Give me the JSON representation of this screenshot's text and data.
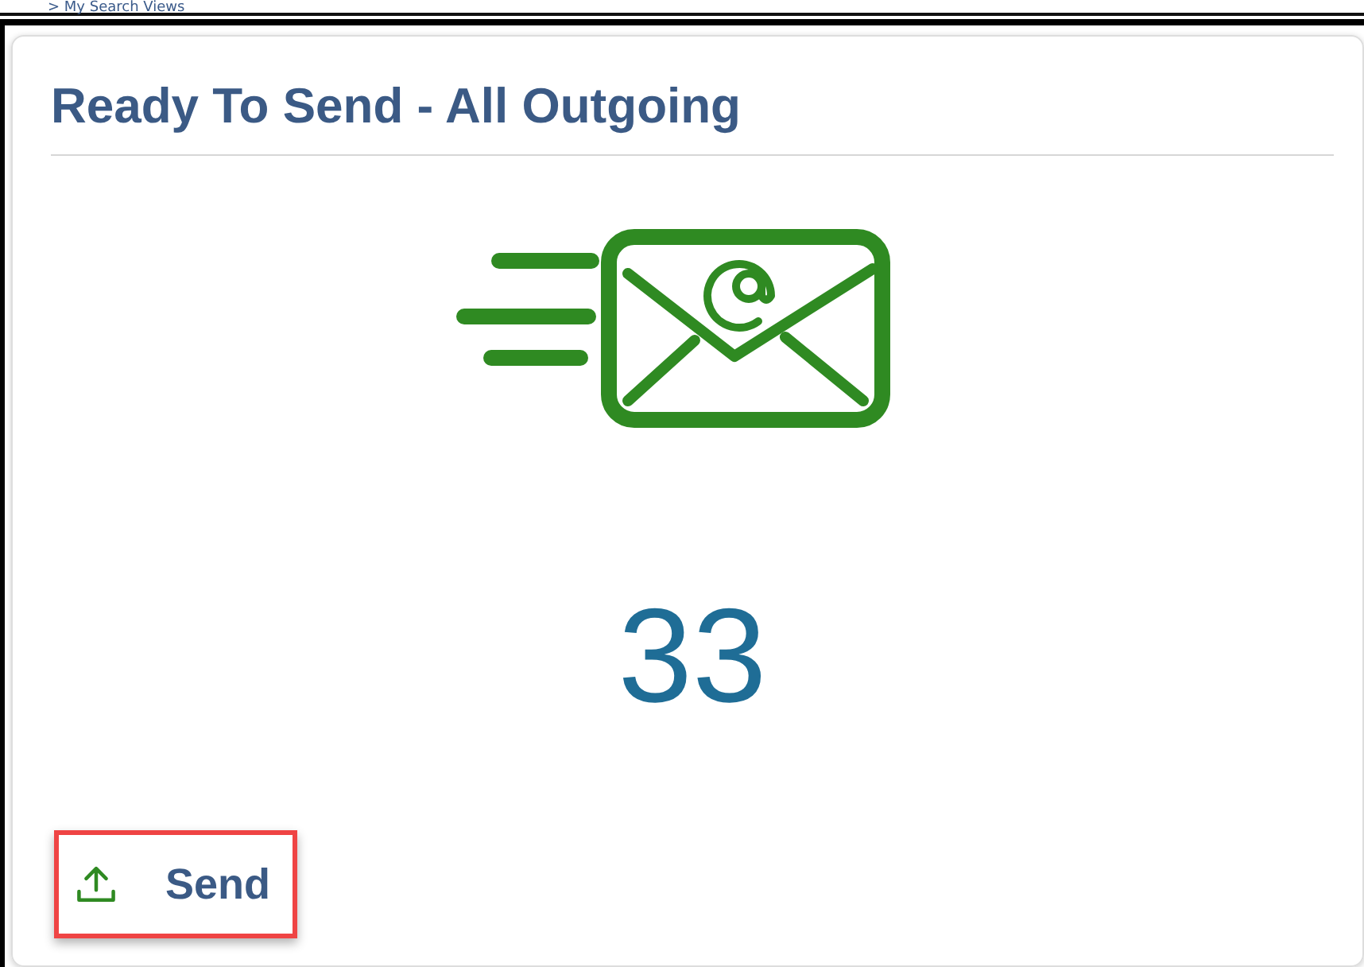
{
  "top_strip": {
    "nav_link": "> My Search Views"
  },
  "card": {
    "title": "Ready To Send - All Outgoing",
    "count": "33",
    "action": {
      "label": "Send",
      "highlighted": true
    }
  }
}
